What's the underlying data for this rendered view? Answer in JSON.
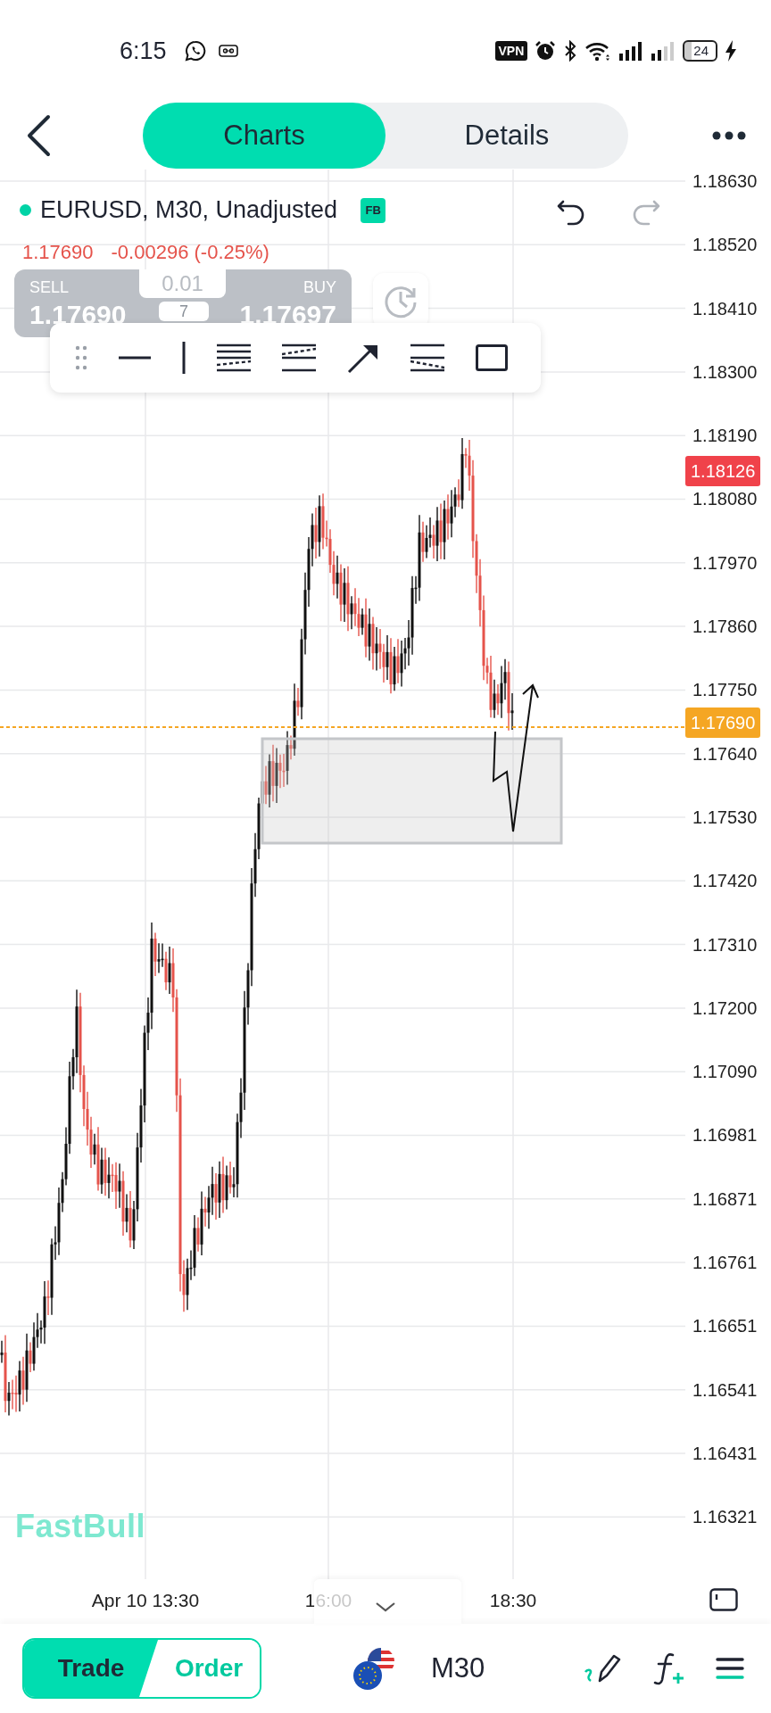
{
  "status_bar": {
    "time": "6:15",
    "vpn": "VPN",
    "battery": "24"
  },
  "header": {
    "tabs": [
      {
        "label": "Charts",
        "selected": true
      },
      {
        "label": "Details",
        "selected": false
      }
    ]
  },
  "symbol": {
    "title": "EURUSD, M30, Unadjusted",
    "badge": "FB",
    "price": "1.17690",
    "change": "-0.00296 (-0.25%)"
  },
  "trade_panel": {
    "sell_label": "SELL",
    "sell_price": "1.17690",
    "lot": "0.01",
    "spread": "7",
    "buy_label": "BUY",
    "buy_price": "1.17697"
  },
  "price_axis": [
    "1.18630",
    "1.18520",
    "1.18410",
    "1.18300",
    "1.18190",
    "1.18080",
    "1.17970",
    "1.17860",
    "1.17750",
    "1.17640",
    "1.17530",
    "1.17420",
    "1.17310",
    "1.17200",
    "1.17090",
    "1.16981",
    "1.16871",
    "1.16761",
    "1.16651",
    "1.16541",
    "1.16431",
    "1.16321"
  ],
  "price_markers": [
    {
      "label": "1.18126",
      "color": "#f0424a"
    },
    {
      "label": "1.17690",
      "color": "#f5a623"
    }
  ],
  "chart_logo": "FastBull",
  "time_axis": [
    "Apr 10 13:30",
    "16:00",
    "18:30"
  ],
  "bottom_bar": {
    "modes": [
      {
        "label": "Trade",
        "selected": true
      },
      {
        "label": "Order",
        "selected": false
      }
    ],
    "timeframe": "M30"
  }
}
